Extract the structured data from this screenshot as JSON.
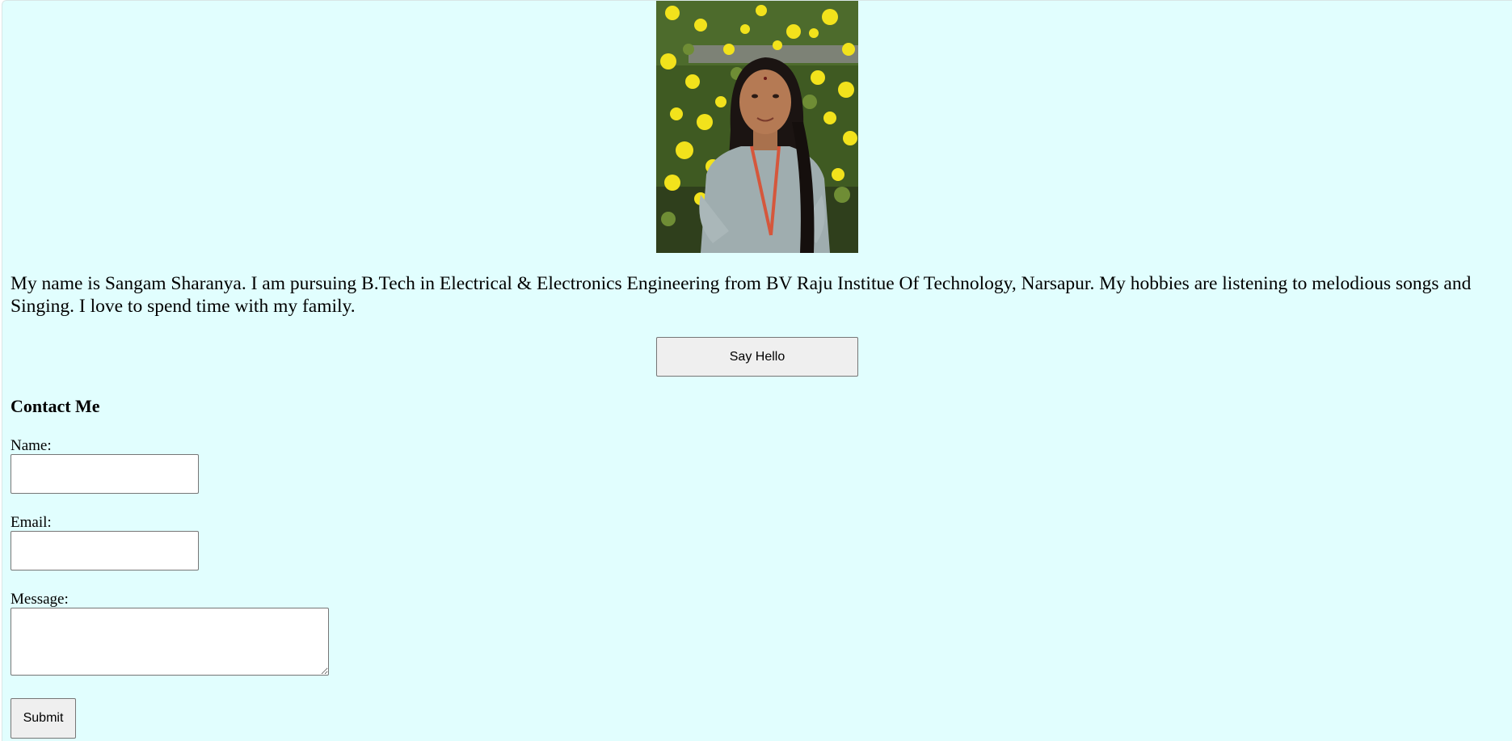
{
  "profile": {
    "photo_alt": "Profile photo",
    "bio": "My name is Sangam Sharanya. I am pursuing B.Tech in Electrical & Electronics Engineering from BV Raju Institue Of Technology, Narsapur. My hobbies are listening to melodious songs and Singing. I love to spend time with my family."
  },
  "actions": {
    "say_hello_label": "Say Hello"
  },
  "contact": {
    "heading": "Contact Me",
    "name_label": "Name:",
    "name_value": "",
    "email_label": "Email:",
    "email_value": "",
    "message_label": "Message:",
    "message_value": "",
    "submit_label": "Submit"
  },
  "colors": {
    "page_background": "#e1fefe",
    "button_background": "#efefef",
    "input_border": "#767676"
  }
}
